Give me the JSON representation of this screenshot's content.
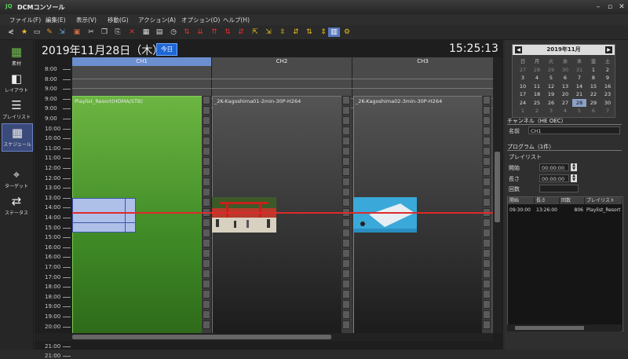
{
  "window": {
    "title": "DCMコンソール",
    "app_icon_text": "JQ"
  },
  "menu": [
    "ファイル(F)",
    "編集(E)",
    "表示(V)",
    "移動(G)",
    "アクション(A)",
    "オプション(O)",
    "ヘルプ(H)"
  ],
  "sidebar": {
    "items": [
      {
        "label": "素材",
        "icon": "material-icon"
      },
      {
        "label": "レイアウト",
        "icon": "layout-icon"
      },
      {
        "label": "プレイリスト",
        "icon": "playlist-icon"
      },
      {
        "label": "スケジュール",
        "icon": "schedule-icon",
        "active": true
      },
      {
        "label": "ターゲット",
        "icon": "target-icon"
      },
      {
        "label": "ステータス",
        "icon": "status-icon"
      }
    ]
  },
  "schedule": {
    "date": "2019年11月28日（木）",
    "today_label": "今日",
    "clock": "15:25:13",
    "channels": [
      "CH1",
      "CH2",
      "CH3"
    ],
    "times": [
      "8:00",
      "8:00",
      "9:00",
      "9:00",
      "9:00",
      "9:00",
      "10:00",
      "10:00",
      "11:00",
      "11:00",
      "12:00",
      "12:00",
      "13:00",
      "13:00",
      "14:00",
      "14:00",
      "15:00",
      "15:00",
      "16:00",
      "16:00",
      "17:00",
      "17:00",
      "18:00",
      "18:00",
      "19:00",
      "19:00",
      "20:00",
      "20:00",
      "21:00",
      "21:00"
    ],
    "events": [
      "Playlist_Resort(HDMA/STB)",
      "_2K-Kagoshima01-2min-30P-H264",
      "_2K-Kagoshima02-3min-30P-H264"
    ]
  },
  "calendar": {
    "title": "2019年11月",
    "weekdays": [
      "日",
      "月",
      "火",
      "水",
      "木",
      "金",
      "土"
    ],
    "weeks": [
      [
        "27",
        "28",
        "29",
        "30",
        "31",
        "1",
        "2"
      ],
      [
        "3",
        "4",
        "5",
        "6",
        "7",
        "8",
        "9"
      ],
      [
        "10",
        "11",
        "12",
        "13",
        "14",
        "15",
        "16"
      ],
      [
        "17",
        "18",
        "19",
        "20",
        "21",
        "22",
        "23"
      ],
      [
        "24",
        "25",
        "26",
        "27",
        "28",
        "29",
        "30"
      ],
      [
        "1",
        "2",
        "3",
        "4",
        "5",
        "6",
        "7"
      ]
    ],
    "selected": "28"
  },
  "channel": {
    "section_title": "チャンネル（HE OEC）",
    "name_label": "名前",
    "name_value": "CH1"
  },
  "program": {
    "section_title": "プログラム（1件）",
    "sub_title": "プレイリスト",
    "start_label": "開始",
    "start_value": "00:00:00",
    "length_label": "長さ",
    "length_value": "00:00:00",
    "count_label": "回数"
  },
  "playlist_table": {
    "headers": [
      "開始",
      "長さ",
      "回数",
      "プレイリスト"
    ],
    "rows": [
      [
        "09:30:00",
        "13:26:00",
        "806",
        "Playlist_Resort"
      ]
    ]
  }
}
